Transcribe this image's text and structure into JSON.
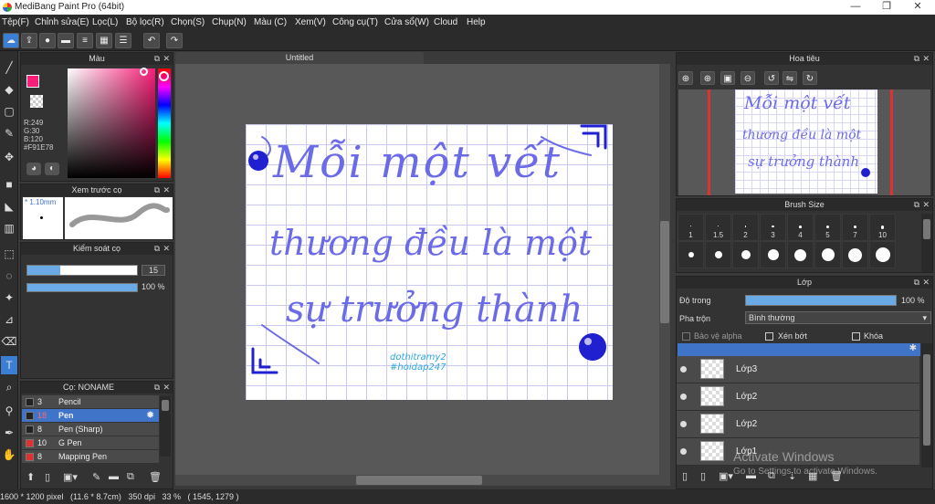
{
  "window": {
    "title": "MediBang Paint Pro (64bit)"
  },
  "menu": [
    "Tệp(F)",
    "Chỉnh sửa(E)",
    "Lọc(L)",
    "Bộ lọc(R)",
    "Chọn(S)",
    "Chụp(N)",
    "Màu (C)",
    "Xem(V)",
    "Công cụ(T)",
    "Cửa sổ(W)",
    "Cloud",
    "Help"
  ],
  "color_panel": {
    "title": "Màu",
    "r": "R:249",
    "g": "G:30",
    "b": "B:120",
    "hex": "#F91E78",
    "primary_color": "#F91E78"
  },
  "brush_preview": {
    "title": "Xem trước cọ",
    "size": "* 1.10mm"
  },
  "brush_control": {
    "title": "Kiểm soát cọ",
    "size_value": "15",
    "opacity_value": "100 %",
    "size_fraction": 0.3,
    "opacity_fraction": 1.0
  },
  "brush_list": {
    "title": "Cọ: NONAME",
    "items": [
      {
        "num": "3",
        "name": "Pencil",
        "color": "#222222",
        "selected": false
      },
      {
        "num": "18",
        "name": "Pen",
        "color": "#222222",
        "selected": true
      },
      {
        "num": "8",
        "name": "Pen (Sharp)",
        "color": "#222222",
        "selected": false
      },
      {
        "num": "10",
        "name": "G Pen",
        "color": "#e03030",
        "selected": false
      },
      {
        "num": "8",
        "name": "Mapping Pen",
        "color": "#e03030",
        "selected": false
      }
    ]
  },
  "document": {
    "tab": "Untitled"
  },
  "artwork": {
    "line1": "Mỗi một vết",
    "line2": "thương đều là một",
    "line3": "sự trưởng thành",
    "credit1": "dothitramy2",
    "credit2": "#hoidap247",
    "ink_color": "#6b6be8",
    "accent_color": "#2020d0",
    "credit_color": "#2aa7e0"
  },
  "navigator": {
    "title": "Hoa tiêu"
  },
  "brush_size": {
    "title": "Brush Size",
    "sizes": [
      "1",
      "1.5",
      "2",
      "3",
      "4",
      "5",
      "7",
      "10"
    ]
  },
  "layers_panel": {
    "title": "Lớp",
    "opacity_label": "Độ trong",
    "opacity_value": "100 %",
    "opacity_fraction": 1.0,
    "blend_label": "Pha trộn",
    "blend_value": "Bình thường",
    "protect_alpha": "Bảo vệ alpha",
    "clipping": "Xén bớt",
    "lock": "Khóa",
    "layers": [
      "Lớp3",
      "Lớp2",
      "Lớp2",
      "Lớp1"
    ]
  },
  "watermark": {
    "line1": "Activate Windows",
    "line2": "Go to Settings to activate Windows."
  },
  "status": {
    "text": "1600 * 1200 pixel   (11.6 * 8.7cm)   350 dpi   33 %   ( 1545, 1279 )"
  }
}
